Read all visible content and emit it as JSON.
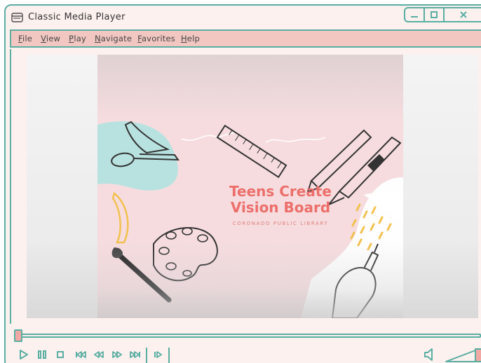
{
  "window": {
    "title": "Classic Media Player",
    "controls": {
      "minimize_icon": "minimize-icon",
      "maximize_icon": "maximize-icon",
      "close_icon": "close-icon"
    }
  },
  "menu": {
    "items": [
      {
        "first": "F",
        "rest": "ile"
      },
      {
        "first": "V",
        "rest": "iew"
      },
      {
        "first": "P",
        "rest": "lay"
      },
      {
        "first": "N",
        "rest": "avigate"
      },
      {
        "first": "F",
        "rest": "avorites"
      },
      {
        "first": "H",
        "rest": "elp"
      }
    ]
  },
  "video": {
    "title_line1": "Teens Create",
    "title_line2": "Vision Board",
    "subtitle": "CORONADO PUBLIC LIBRARY"
  },
  "playback": {
    "progress": 0.0
  },
  "controls": {
    "icons": [
      "play-icon",
      "pause-icon",
      "stop-icon",
      "skip-back-icon",
      "rewind-icon",
      "fast-forward-icon",
      "skip-forward-icon",
      "step-frame-icon",
      "volume-icon"
    ],
    "volume": 1.0
  },
  "colors": {
    "accent": "#5aaea2",
    "menu_bg": "#f2c7c2",
    "window_bg": "#fdf1ef",
    "title_text": "#ec6f6a"
  }
}
